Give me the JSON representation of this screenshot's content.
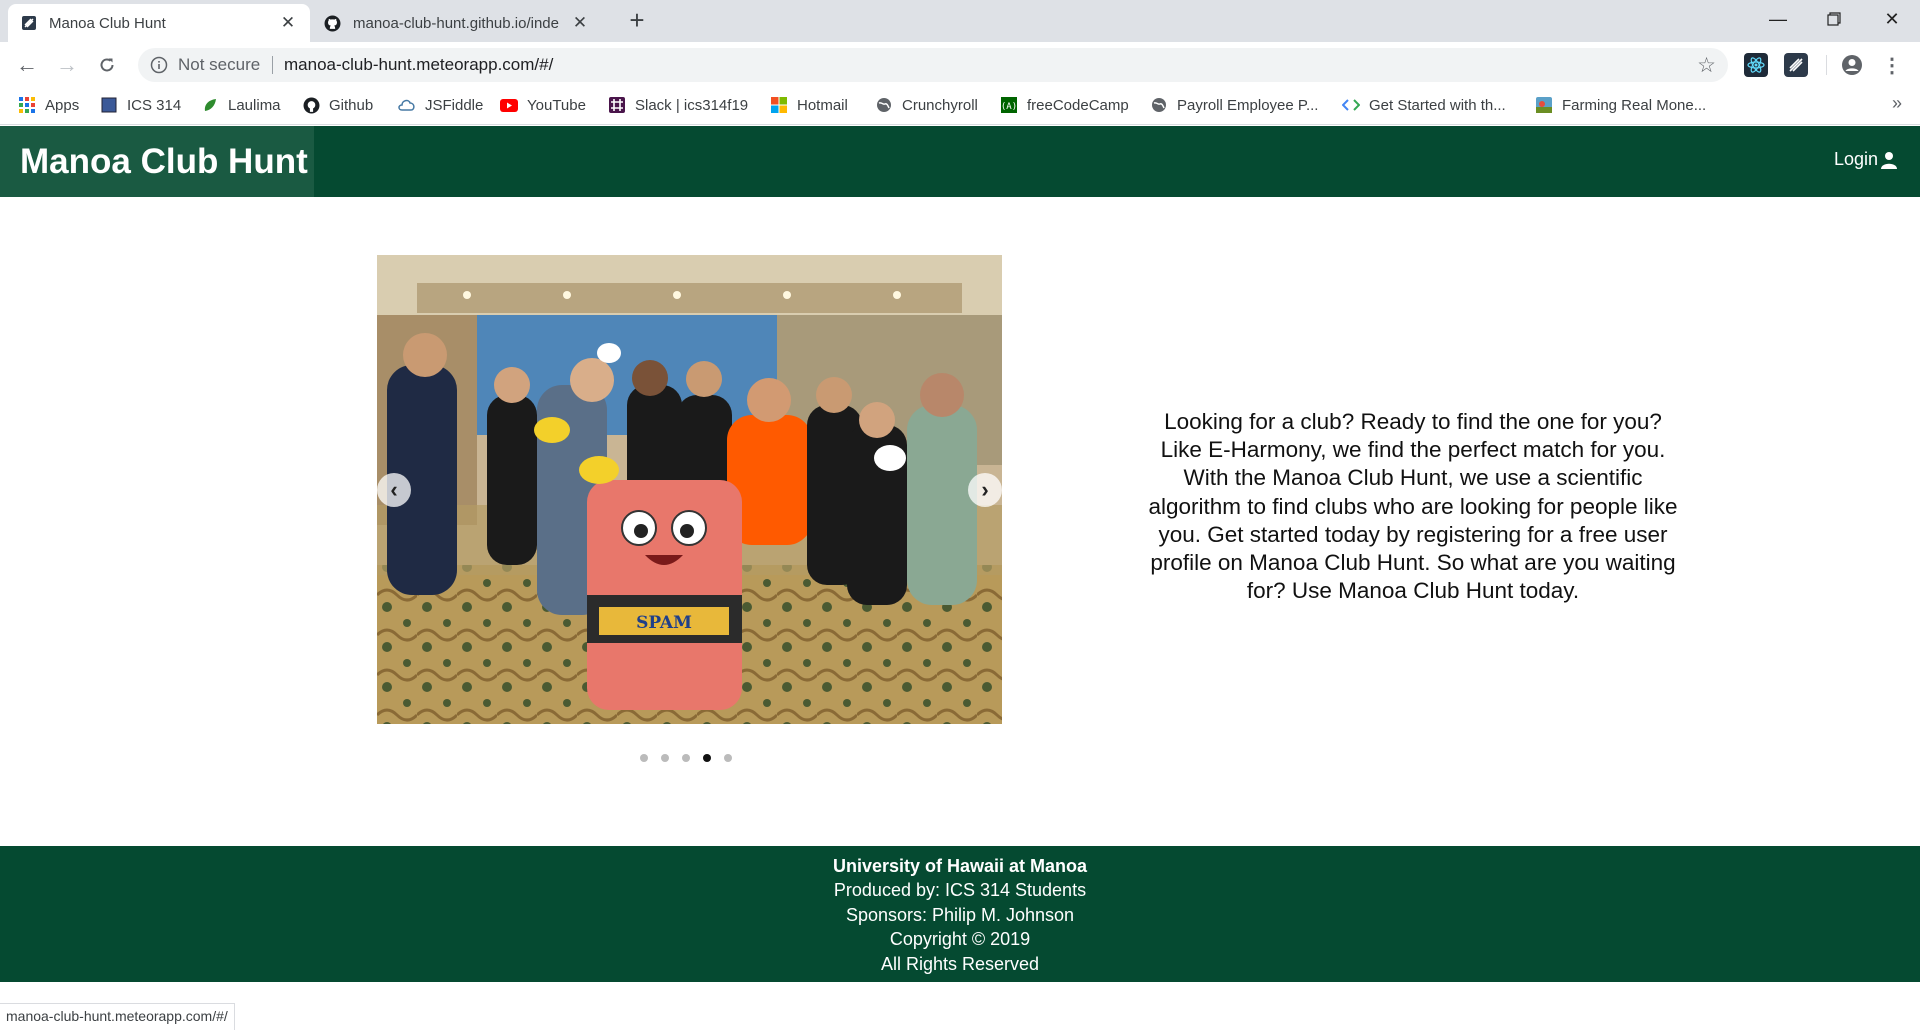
{
  "browser": {
    "tabs": [
      {
        "title": "Manoa Club Hunt",
        "icon": "meteor-favicon",
        "active": true
      },
      {
        "title": "manoa-club-hunt.github.io/inde",
        "icon": "github-icon",
        "active": false
      }
    ],
    "omnibox": {
      "security_label": "Not secure",
      "url": "manoa-club-hunt.meteorapp.com/#/"
    },
    "bookmarks": [
      {
        "label": "Apps",
        "icon": "apps-grid-icon"
      },
      {
        "label": "ICS 314",
        "icon": "ics-icon"
      },
      {
        "label": "Laulima",
        "icon": "laulima-icon"
      },
      {
        "label": "Github",
        "icon": "github-icon"
      },
      {
        "label": "JSFiddle",
        "icon": "jsfiddle-icon"
      },
      {
        "label": "YouTube",
        "icon": "youtube-icon"
      },
      {
        "label": "Slack | ics314f19",
        "icon": "slack-icon"
      },
      {
        "label": "Hotmail",
        "icon": "microsoft-icon"
      },
      {
        "label": "Crunchyroll",
        "icon": "globe-icon"
      },
      {
        "label": "freeCodeCamp",
        "icon": "freecodecamp-icon"
      },
      {
        "label": "Payroll Employee P...",
        "icon": "globe-icon"
      },
      {
        "label": "Get Started with th...",
        "icon": "code-icon"
      },
      {
        "label": "Farming Real Mone...",
        "icon": "farm-icon"
      }
    ],
    "more_label": "»",
    "status_url": "manoa-club-hunt.meteorapp.com/#/"
  },
  "site": {
    "brand": "Manoa Club Hunt",
    "login_label": "Login",
    "carousel": {
      "image_text": "SPAM",
      "slide_count": 5,
      "active_slide": 4
    },
    "tagline": "Looking for a club? Ready to find the one for you? Like E-Harmony, we find the perfect match for you. With the Manoa Club Hunt, we use a scientific algorithm to find clubs who are looking for people like you. Get started today by registering for a free user profile on Manoa Club Hunt. So what are you waiting for? Use Manoa Club Hunt today.",
    "footer": {
      "line1": "University of Hawaii at Manoa",
      "line2": "Produced by: ICS 314 Students",
      "line3": "Sponsors: Philip M. Johnson",
      "line4": "Copyright © 2019",
      "line5": "All Rights Reserved"
    }
  },
  "colors": {
    "nav_green": "#054a31",
    "brand_box": "#1a5a42"
  }
}
